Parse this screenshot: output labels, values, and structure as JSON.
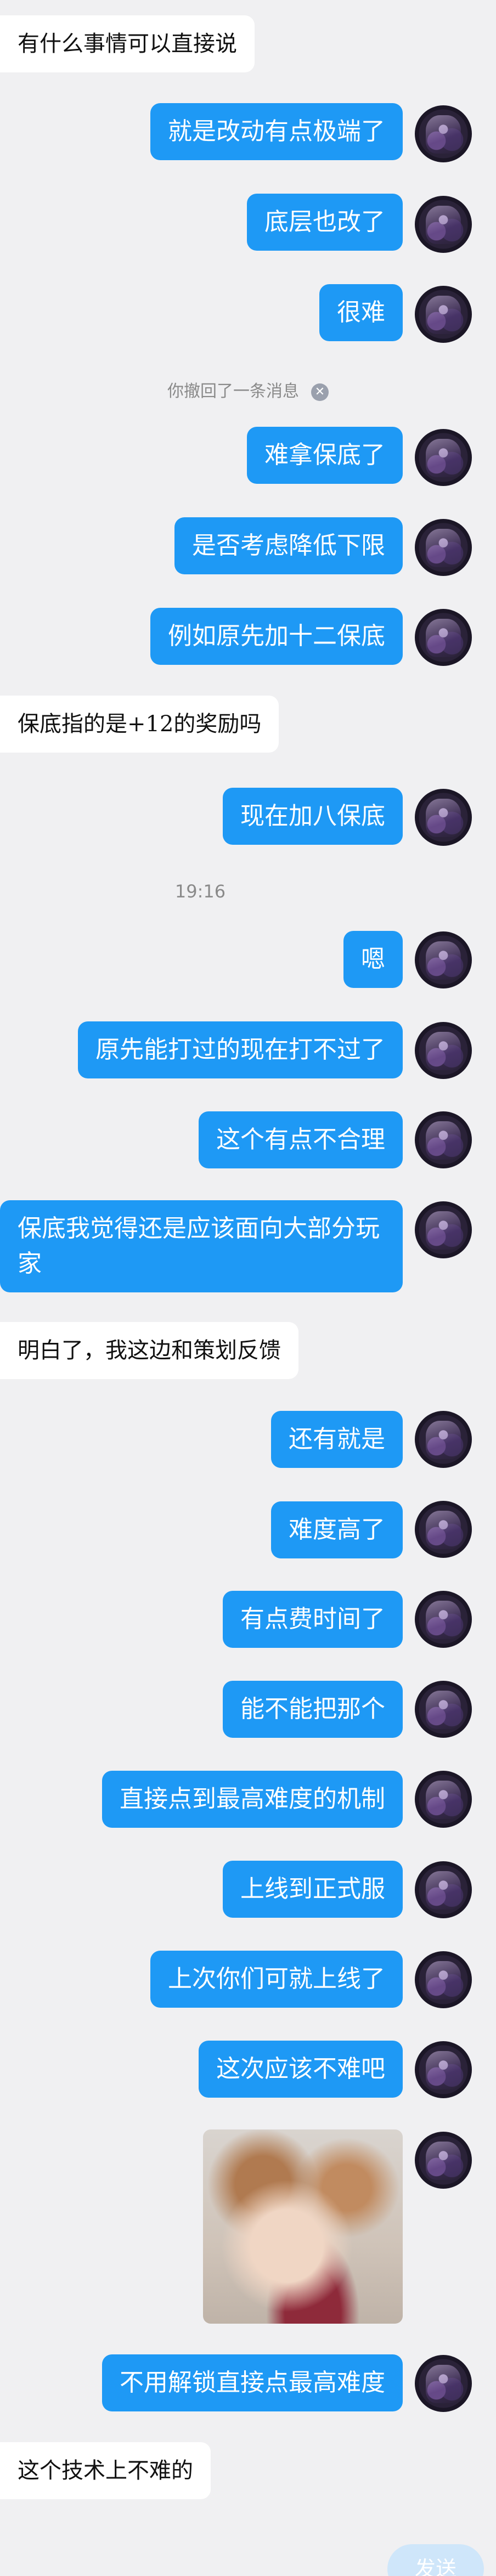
{
  "messages": [
    {
      "side": "in",
      "text": "有什么事情可以直接说"
    },
    {
      "side": "out",
      "text": "就是改动有点极端了"
    },
    {
      "side": "out",
      "text": "底层也改了"
    },
    {
      "side": "out",
      "text": "很难"
    },
    {
      "side": "out",
      "text": "难拿保底了"
    },
    {
      "side": "out",
      "text": "是否考虑降低下限"
    },
    {
      "side": "out",
      "text": "例如原先加十二保底"
    },
    {
      "side": "in",
      "text": "保底指的是+12的奖励吗"
    },
    {
      "side": "out",
      "text": "现在加八保底"
    },
    {
      "side": "out",
      "text": "嗯"
    },
    {
      "side": "out",
      "text": "原先能打过的现在打不过了"
    },
    {
      "side": "out",
      "text": "这个有点不合理"
    },
    {
      "side": "out",
      "text": "保底我觉得还是应该面向大部分玩家"
    },
    {
      "side": "in",
      "text": "明白了，我这边和策划反馈"
    },
    {
      "side": "out",
      "text": "还有就是"
    },
    {
      "side": "out",
      "text": "难度高了"
    },
    {
      "side": "out",
      "text": "有点费时间了"
    },
    {
      "side": "out",
      "text": "能不能把那个"
    },
    {
      "side": "out",
      "text": "直接点到最高难度的机制"
    },
    {
      "side": "out",
      "text": "上线到正式服"
    },
    {
      "side": "out",
      "text": "上次你们可就上线了"
    },
    {
      "side": "out",
      "text": "这次应该不难吧"
    },
    {
      "side": "out",
      "text": "不用解锁直接点最高难度"
    },
    {
      "side": "in",
      "text": "这个技术上不难的"
    }
  ],
  "system_notice": "你撤回了一条消息",
  "timestamp": "19:16",
  "send_label": "发送",
  "icons": {
    "recall": "x-circle-icon",
    "avatar": "user-avatar"
  }
}
